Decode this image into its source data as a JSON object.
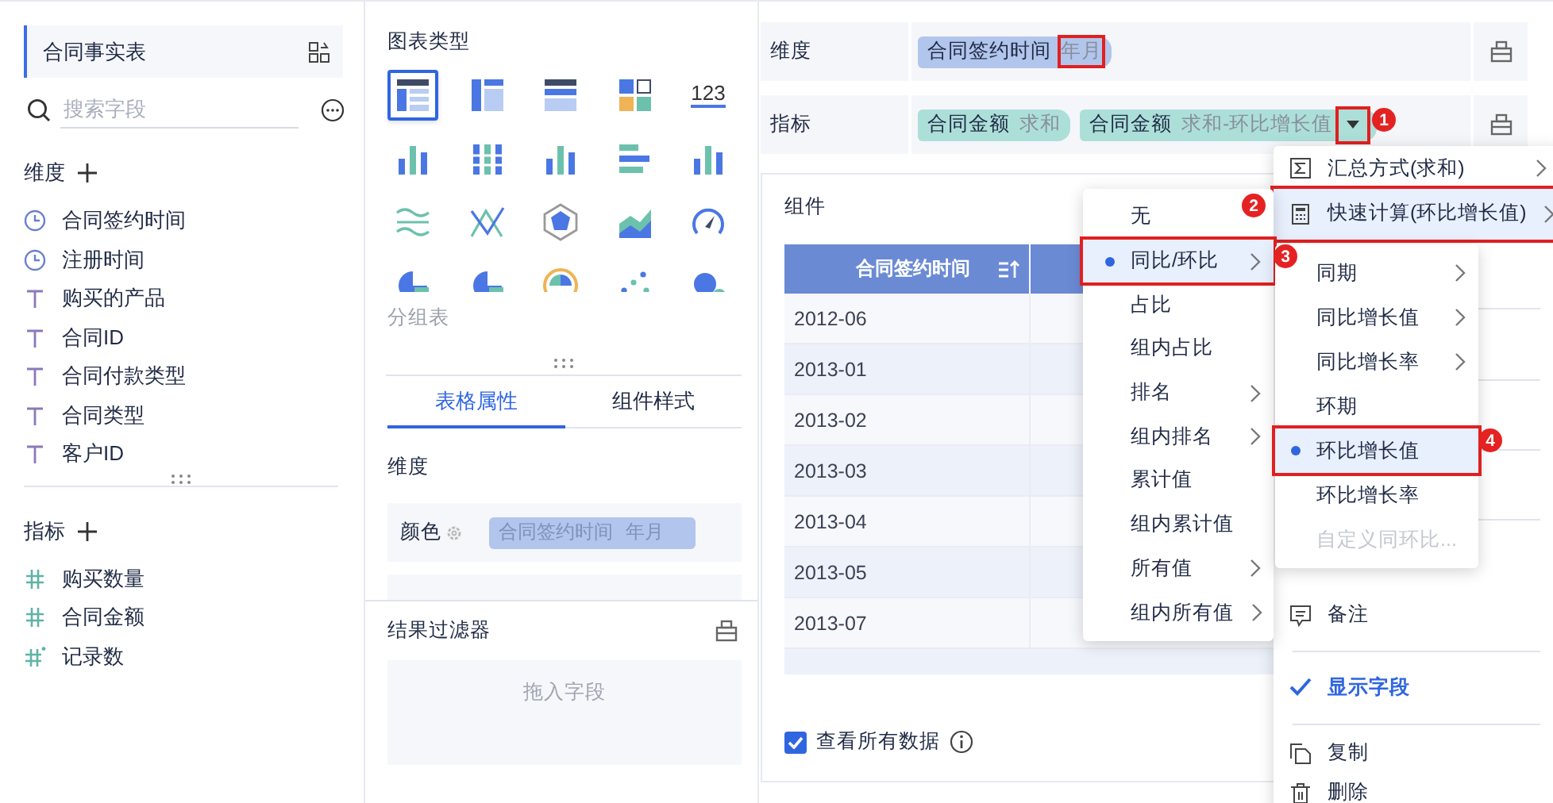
{
  "left_panel": {
    "table_name": "合同事实表",
    "search": {
      "placeholder": "搜索字段"
    },
    "dimensions": {
      "title": "维度",
      "fields": [
        {
          "name": "合同签约时间",
          "kind": "date"
        },
        {
          "name": "注册时间",
          "kind": "date"
        },
        {
          "name": "购买的产品",
          "kind": "text"
        },
        {
          "name": "合同ID",
          "kind": "text"
        },
        {
          "name": "合同付款类型",
          "kind": "text"
        },
        {
          "name": "合同类型",
          "kind": "text"
        },
        {
          "name": "客户ID",
          "kind": "text"
        }
      ]
    },
    "measures": {
      "title": "指标",
      "fields": [
        {
          "name": "购买数量",
          "kind": "number"
        },
        {
          "name": "合同金额",
          "kind": "number"
        },
        {
          "name": "记录数",
          "kind": "count"
        }
      ]
    }
  },
  "middle_panel": {
    "chart_types_title": "图表类型",
    "chart_types": [
      {
        "kind": "table",
        "selected": true
      },
      {
        "kind": "cross-table",
        "selected": false
      },
      {
        "kind": "detail-table",
        "selected": false
      },
      {
        "kind": "tiles",
        "selected": false
      },
      {
        "kind": "number",
        "label": "123",
        "selected": false
      },
      {
        "kind": "bar",
        "selected": false
      },
      {
        "kind": "stacked-bar",
        "selected": false
      },
      {
        "kind": "bar",
        "selected": false
      },
      {
        "kind": "horizontal-bar",
        "selected": false
      },
      {
        "kind": "bar",
        "selected": false
      },
      {
        "kind": "wave",
        "selected": false
      },
      {
        "kind": "line",
        "selected": false
      },
      {
        "kind": "radar",
        "selected": false
      },
      {
        "kind": "area",
        "selected": false
      },
      {
        "kind": "gauge",
        "selected": false
      },
      {
        "kind": "pie",
        "selected": false
      },
      {
        "kind": "pie",
        "selected": false
      },
      {
        "kind": "rose",
        "selected": false
      },
      {
        "kind": "scatter",
        "selected": false
      },
      {
        "kind": "bubble",
        "selected": false
      }
    ],
    "chart_type_label": "分组表",
    "tabs": [
      {
        "label": "表格属性",
        "selected": true
      },
      {
        "label": "组件样式",
        "selected": false
      }
    ],
    "section_title": "维度",
    "attribute_rows": [
      {
        "label": "颜色",
        "field": "合同签约时间",
        "detail": "年月"
      }
    ],
    "filter": {
      "title": "结果过滤器",
      "placeholder": "拖入字段"
    }
  },
  "right_panel": {
    "dimension_row": {
      "label": "维度",
      "pills": [
        {
          "name": "合同签约时间",
          "detail": "年月",
          "outlined": true
        }
      ]
    },
    "measure_row": {
      "label": "指标",
      "pills": [
        {
          "name": "合同金额",
          "detail": "求和",
          "dropdown": false
        },
        {
          "name": "合同金额",
          "detail": "求和-环比增长值",
          "dropdown": true,
          "outlined": true
        }
      ]
    },
    "component": {
      "title": "组件",
      "table": {
        "columns": [
          "合同签约时间"
        ],
        "rows": [
          "2012-06",
          "2013-01",
          "2013-02",
          "2013-03",
          "2013-04",
          "2013-05",
          "2013-07"
        ]
      },
      "show_all": {
        "label": "查看所有数据",
        "checked": true
      }
    }
  },
  "field_menu": {
    "items": [
      {
        "label": "汇总方式(求和)",
        "submenu": true,
        "selected": false
      },
      {
        "label": "快速计算(环比增长值)",
        "submenu": true,
        "selected": true,
        "outlined": true
      },
      {
        "label": "备注",
        "submenu": false,
        "selected": false
      },
      {
        "label": "显示字段",
        "submenu": false,
        "selected": false,
        "checked": true
      },
      {
        "label": "复制",
        "submenu": false,
        "selected": false
      },
      {
        "label": "删除",
        "submenu": false,
        "selected": false
      }
    ]
  },
  "quick_calc_menu": {
    "items": [
      {
        "label": "无",
        "submenu": false,
        "selected": false
      },
      {
        "label": "同比/环比",
        "submenu": true,
        "selected": true,
        "outlined": true
      },
      {
        "label": "占比",
        "submenu": false,
        "selected": false
      },
      {
        "label": "组内占比",
        "submenu": false,
        "selected": false
      },
      {
        "label": "排名",
        "submenu": true,
        "selected": false
      },
      {
        "label": "组内排名",
        "submenu": true,
        "selected": false
      },
      {
        "label": "累计值",
        "submenu": false,
        "selected": false
      },
      {
        "label": "组内累计值",
        "submenu": false,
        "selected": false
      },
      {
        "label": "所有值",
        "submenu": true,
        "selected": false
      },
      {
        "label": "组内所有值",
        "submenu": true,
        "selected": false
      }
    ]
  },
  "compare_menu": {
    "items": [
      {
        "label": "同期",
        "submenu": true,
        "selected": false,
        "disabled": false
      },
      {
        "label": "同比增长值",
        "submenu": true,
        "selected": false,
        "disabled": false
      },
      {
        "label": "同比增长率",
        "submenu": true,
        "selected": false,
        "disabled": false
      },
      {
        "label": "环期",
        "submenu": false,
        "selected": false,
        "disabled": false
      },
      {
        "label": "环比增长值",
        "submenu": false,
        "selected": true,
        "disabled": false,
        "outlined": true
      },
      {
        "label": "环比增长率",
        "submenu": false,
        "selected": false,
        "disabled": false
      },
      {
        "label": "自定义同环比...",
        "submenu": false,
        "selected": false,
        "disabled": true
      }
    ]
  },
  "annotations": [
    {
      "number": "1"
    },
    {
      "number": "2"
    },
    {
      "number": "3"
    },
    {
      "number": "4"
    }
  ]
}
